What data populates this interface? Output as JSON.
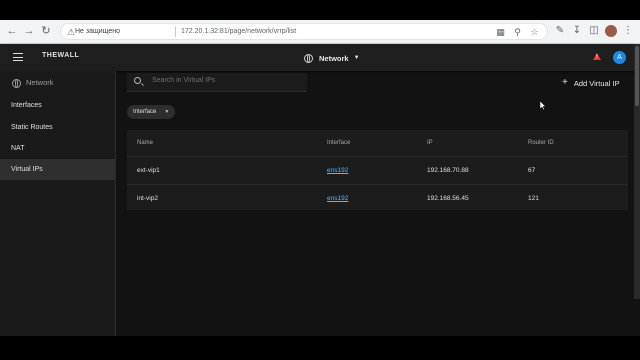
{
  "browser": {
    "security_label": "Не защищено",
    "url": "172.20.1.32:81/page/network/vrrp/list"
  },
  "app": {
    "brand": "THEWALL",
    "section_selector": "Network",
    "avatar_initial": "A",
    "alert_symbol": "!"
  },
  "sidebar": {
    "header": "Network",
    "items": [
      {
        "label": "Interfaces",
        "active": false
      },
      {
        "label": "Static Routes",
        "active": false
      },
      {
        "label": "NAT",
        "active": false
      },
      {
        "label": "Virtual IPs",
        "active": true
      }
    ]
  },
  "toolbar": {
    "search_placeholder": "Search in Virtual IPs",
    "add_label": "Add Virtual IP",
    "filter_label": "Interface"
  },
  "table": {
    "columns": [
      "Name",
      "Interface",
      "IP",
      "Router ID"
    ],
    "rows": [
      {
        "name": "ext-vip1",
        "interface": "ens192",
        "ip": "192.168.70.88",
        "router_id": "67"
      },
      {
        "name": "int-vip2",
        "interface": "ens192",
        "ip": "192.168.56.45",
        "router_id": "121"
      }
    ]
  },
  "colors": {
    "background": "#121212",
    "accent_link": "#64b5f6",
    "alert": "#e53935",
    "avatar": "#1e88e5"
  }
}
